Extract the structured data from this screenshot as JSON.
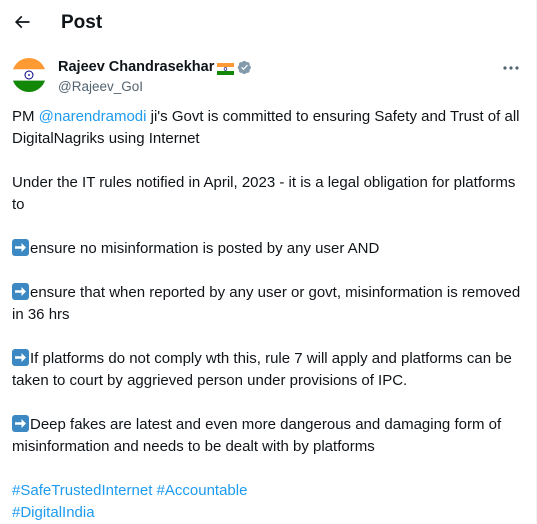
{
  "header": {
    "title": "Post",
    "back_icon": "arrow-left-icon"
  },
  "author": {
    "name": "Rajeev Chandrasekhar",
    "handle": "@Rajeev_GoI",
    "flag": "india-flag-emoji",
    "verified": "verified-badge-icon",
    "avatar": "india-flag-avatar"
  },
  "post": {
    "line1_prefix": "PM ",
    "mention": "@narendramodi",
    "line1_suffix": " ji's Govt is committed to ensuring Safety and Trust of all DigitalNagriks using Internet",
    "para2": "Under the IT rules notified in April, 2023 - it is a legal obligation for platforms to",
    "bullet1": "ensure no misinformation is posted by any user  AND",
    "bullet2": "ensure that when reported by any user or govt, misinformation is removed in 36 hrs",
    "bullet3": "If platforms do not comply wth this, rule 7 will apply and platforms can be taken to court by aggrieved person under provisions of IPC.",
    "bullet4": "Deep fakes are latest and even more dangerous and damaging form of misinformation and needs to be dealt with by platforms",
    "hashtag1": "#SafeTrustedInternet",
    "hashtag2": "#Accountable",
    "hashtag3": "#DigitalIndia"
  },
  "colors": {
    "link": "#1d9bf0",
    "text": "#0f1419",
    "secondary": "#536471",
    "arrow_emoji_bg": "#3b88c3"
  }
}
